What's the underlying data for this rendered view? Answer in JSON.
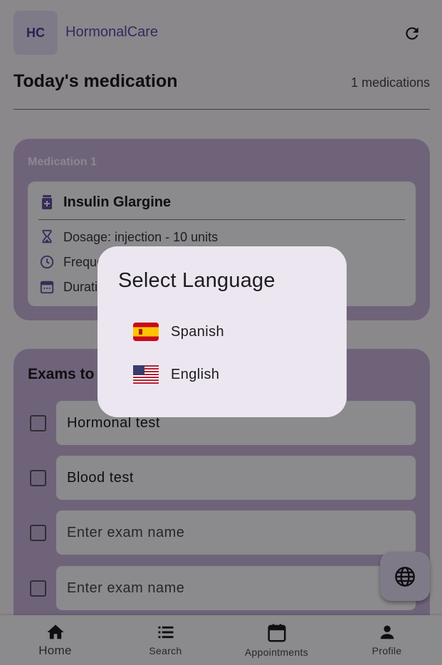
{
  "app": {
    "logo_text": "HC",
    "brand": "HormonalCare"
  },
  "header": {
    "title": "Today's medication",
    "count": "1 medications"
  },
  "medication": {
    "label": "Medication 1",
    "name": "Insulin Glargine",
    "dosage": "Dosage: injection - 10 units",
    "frequency_visible": "Freque",
    "duration_visible": "Durati"
  },
  "exams": {
    "title_visible": "Exams to",
    "items": [
      {
        "value": "Hormonal test",
        "placeholder": ""
      },
      {
        "value": "Blood test",
        "placeholder": ""
      },
      {
        "value": "",
        "placeholder": "Enter exam name"
      },
      {
        "value": "",
        "placeholder": "Enter exam name"
      }
    ]
  },
  "nav": {
    "items": [
      {
        "label": "Home",
        "icon": "home-icon"
      },
      {
        "label": "Search",
        "icon": "list-icon"
      },
      {
        "label": "Appointments",
        "icon": "calendar-icon"
      },
      {
        "label": "Profile",
        "icon": "person-icon"
      }
    ]
  },
  "dialog": {
    "title": "Select Language",
    "options": [
      {
        "label": "Spanish",
        "icon": "spain-flag-icon"
      },
      {
        "label": "English",
        "icon": "us-flag-icon"
      }
    ]
  },
  "colors": {
    "primary": "#5b4db0",
    "card": "#cbb4df",
    "surface": "#fefbff",
    "dialog": "#ece6f0"
  }
}
